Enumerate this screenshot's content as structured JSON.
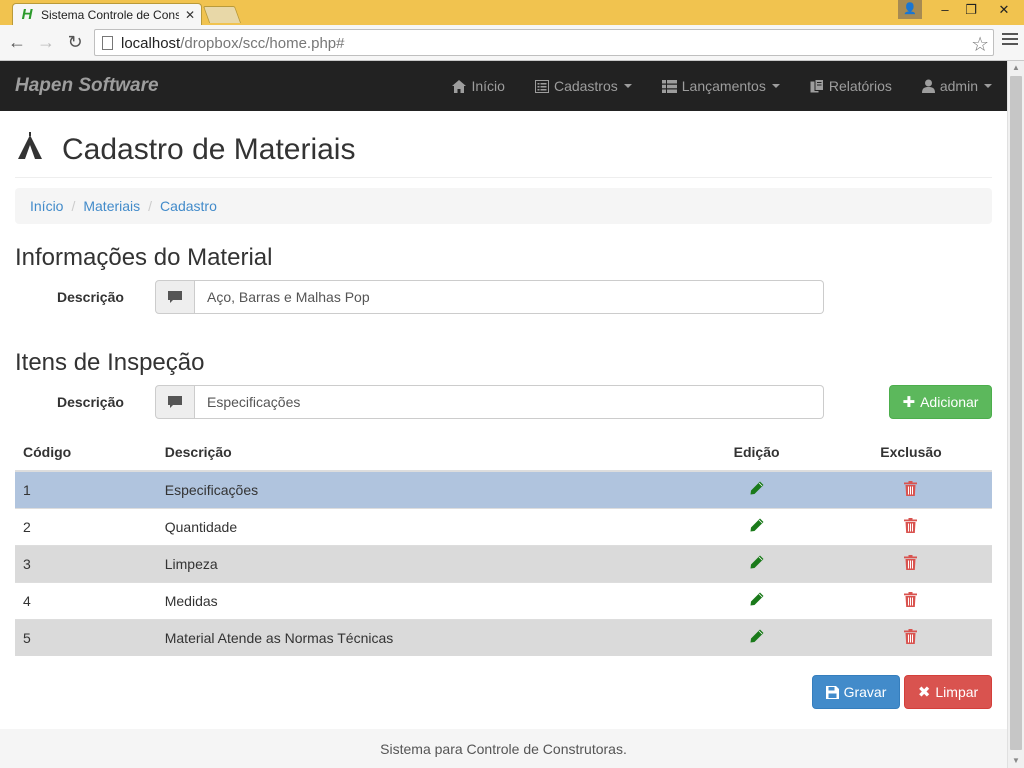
{
  "browser": {
    "tab_title": "Sistema Controle de Cons",
    "tab_favicon": "H",
    "url_host": "localhost",
    "url_path": "/dropbox/scc/home.php#"
  },
  "navbar": {
    "brand": "Hapen Software",
    "items": [
      {
        "label": "Início",
        "icon": "home-icon",
        "dropdown": false
      },
      {
        "label": "Cadastros",
        "icon": "list-alt-icon",
        "dropdown": true
      },
      {
        "label": "Lançamentos",
        "icon": "th-list-icon",
        "dropdown": true
      },
      {
        "label": "Relatórios",
        "icon": "duplicate-icon",
        "dropdown": false
      },
      {
        "label": "admin",
        "icon": "user-icon",
        "dropdown": true
      }
    ]
  },
  "page": {
    "title": "Cadastro de Materiais",
    "breadcrumb": [
      "Início",
      "Materiais",
      "Cadastro"
    ]
  },
  "material": {
    "section_title": "Informações do Material",
    "label": "Descrição",
    "value": "Aço, Barras e Malhas Pop"
  },
  "inspection": {
    "section_title": "Itens de Inspeção",
    "label": "Descrição",
    "value": "Especificações",
    "add_button": "Adicionar"
  },
  "table": {
    "headers": [
      "Código",
      "Descrição",
      "Edição",
      "Exclusão"
    ],
    "rows": [
      {
        "code": "1",
        "description": "Especificações"
      },
      {
        "code": "2",
        "description": "Quantidade"
      },
      {
        "code": "3",
        "description": "Limpeza"
      },
      {
        "code": "4",
        "description": "Medidas"
      },
      {
        "code": "5",
        "description": "Material Atende as Normas Técnicas"
      }
    ]
  },
  "actions": {
    "save": "Gravar",
    "clear": "Limpar"
  },
  "footer": "Sistema para Controle de Construtoras.",
  "colors": {
    "navbar": "#222222",
    "link": "#428bca",
    "success": "#5cb85c",
    "primary": "#428bca",
    "danger": "#d9534f",
    "selected_row": "#b0c4de",
    "edit_icon": "#1a7a1a",
    "delete_icon": "#d9534f"
  }
}
